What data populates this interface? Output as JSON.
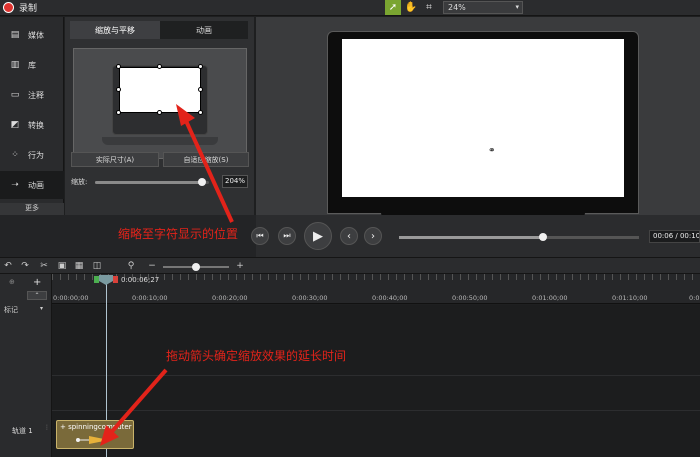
{
  "app": {
    "title": "录制",
    "zoom": "24%",
    "accent_color": "#7aa531",
    "record_color": "#e0332f"
  },
  "toolbar": {
    "tools": [
      "pointer-icon",
      "hand-icon",
      "crop-icon"
    ]
  },
  "sidebar": {
    "items": [
      {
        "label": "媒体",
        "icon": "media-icon"
      },
      {
        "label": "库",
        "icon": "library-icon"
      },
      {
        "label": "注释",
        "icon": "annotation-icon"
      },
      {
        "label": "转换",
        "icon": "transition-icon"
      },
      {
        "label": "行为",
        "icon": "behavior-icon"
      },
      {
        "label": "动画",
        "icon": "animation-icon"
      }
    ],
    "more": "更多"
  },
  "panel": {
    "tabs": [
      "缩放与平移",
      "动画"
    ],
    "actual_size_btn": "实际尺寸(A)",
    "auto_zoom_btn": "自适应缩放(S)",
    "scale_label": "缩放:",
    "scale_value": "204%",
    "scale_fraction": 0.94
  },
  "playback": {
    "timecode": "00:06 / 00:10",
    "progress_fraction": 0.6
  },
  "timeline": {
    "playhead_time": "0:00:06;27",
    "marker_label": "标记",
    "track_label": "轨道 1",
    "ruler_ticks": [
      "0:00:00;00",
      "0:00:10;00",
      "0:00:20;00",
      "0:00:30;00",
      "0:00:40;00",
      "0:00:50;00",
      "0:01:00;00",
      "0:01:10;00",
      "0:01:"
    ],
    "clip_title": "spinningcomputer",
    "zoom_fraction": 0.5
  },
  "annotations": {
    "top": "缩略至字符显示的位置",
    "bottom": "拖动箭头确定缩放效果的延长时间",
    "color": "#e2231a"
  }
}
